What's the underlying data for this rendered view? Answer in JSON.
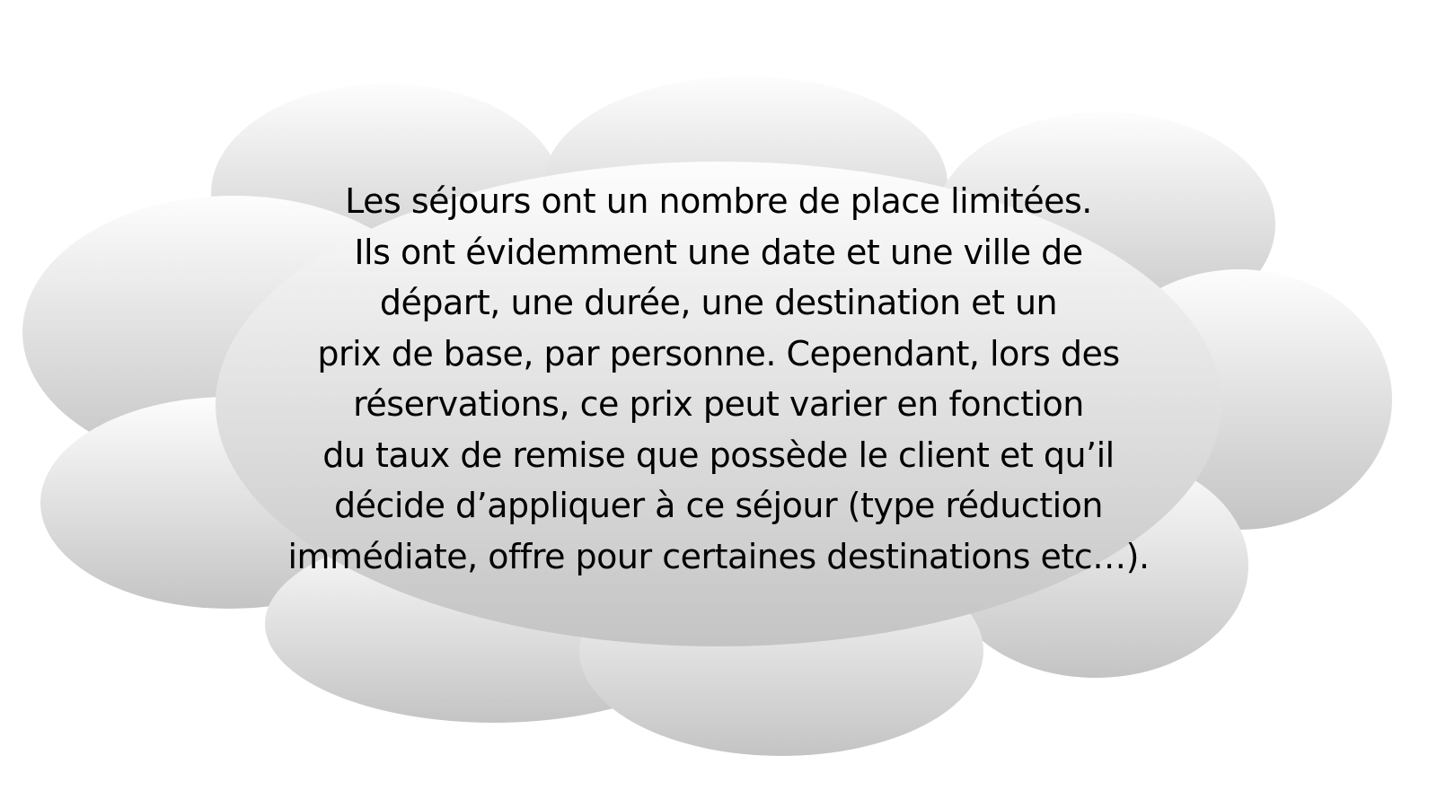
{
  "cloud": {
    "colors": {
      "gradient_top": "#fdfdfd",
      "gradient_bottom": "#c4c4c4",
      "text": "#000000"
    },
    "lines": [
      "Les séjours ont un nombre de place limitées.",
      "Ils ont évidemment une date et une ville de",
      "départ, une durée, une destination et un",
      "prix de base, par personne. Cependant, lors des",
      "réservations, ce prix peut varier en fonction",
      "du taux de remise que possède le client et qu’il",
      "décide d’appliquer à ce séjour (type réduction",
      "immédiate, offre pour certaines destinations etc…)."
    ]
  }
}
